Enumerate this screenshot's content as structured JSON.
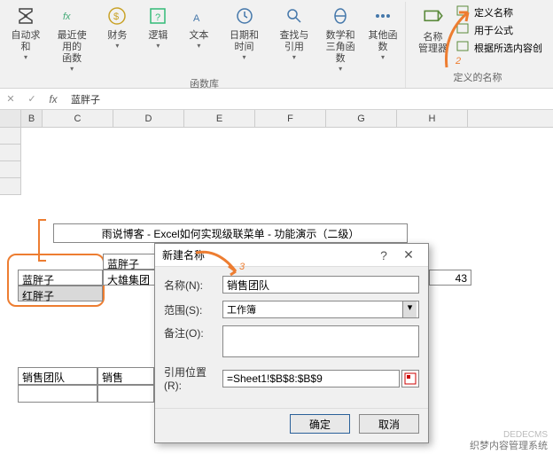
{
  "ribbon": {
    "groups": [
      {
        "name": "functions",
        "title": "函数库",
        "items": [
          {
            "id": "autosum",
            "label": "自动求和",
            "icon": "sigma"
          },
          {
            "id": "recent",
            "label": "最近使用的\n函数",
            "icon": "fx-recent"
          },
          {
            "id": "financial",
            "label": "财务",
            "icon": "money"
          },
          {
            "id": "logical",
            "label": "逻辑",
            "icon": "question"
          },
          {
            "id": "text",
            "label": "文本",
            "icon": "text-a"
          },
          {
            "id": "datetime",
            "label": "日期和时间",
            "icon": "clock"
          },
          {
            "id": "lookup",
            "label": "查找与引用",
            "icon": "lookup"
          },
          {
            "id": "math",
            "label": "数学和\n三角函数",
            "icon": "theta"
          },
          {
            "id": "other",
            "label": "其他函数",
            "icon": "dots"
          }
        ]
      },
      {
        "name": "names",
        "title": "定义的名称",
        "big": {
          "id": "namemgr",
          "label": "名称\n管理器",
          "icon": "tag"
        },
        "small": [
          {
            "id": "define",
            "label": "定义名称",
            "icon": "tag-sm"
          },
          {
            "id": "useinfx",
            "label": "用于公式",
            "icon": "fx-sm"
          },
          {
            "id": "createfromsel",
            "label": "根据所选内容创",
            "icon": "grid-sm"
          }
        ]
      }
    ]
  },
  "formula_bar": {
    "value": "蓝胖子"
  },
  "columns": [
    "B",
    "C",
    "D",
    "E",
    "F",
    "G",
    "H"
  ],
  "sheet": {
    "title": "雨说博客 - Excel如何实现级联菜单 - 功能演示（二级）",
    "left_col": [
      "蓝胖子",
      "红胖子"
    ],
    "mid": [
      "蓝胖子",
      "大雄集团"
    ],
    "right_val": "43",
    "bottom": [
      "销售团队",
      "销售"
    ]
  },
  "dialog": {
    "title": "新建名称",
    "labels": {
      "name": "名称(N):",
      "scope": "范围(S):",
      "comment": "备注(O):",
      "refers": "引用位置(R):"
    },
    "values": {
      "name": "销售团队",
      "scope": "工作簿",
      "refers": "=Sheet1!$B$8:$B$9"
    },
    "buttons": {
      "ok": "确定",
      "cancel": "取消"
    }
  },
  "watermark": {
    "line1": "织梦内容管理系统",
    "line2": "DEDECMS"
  }
}
